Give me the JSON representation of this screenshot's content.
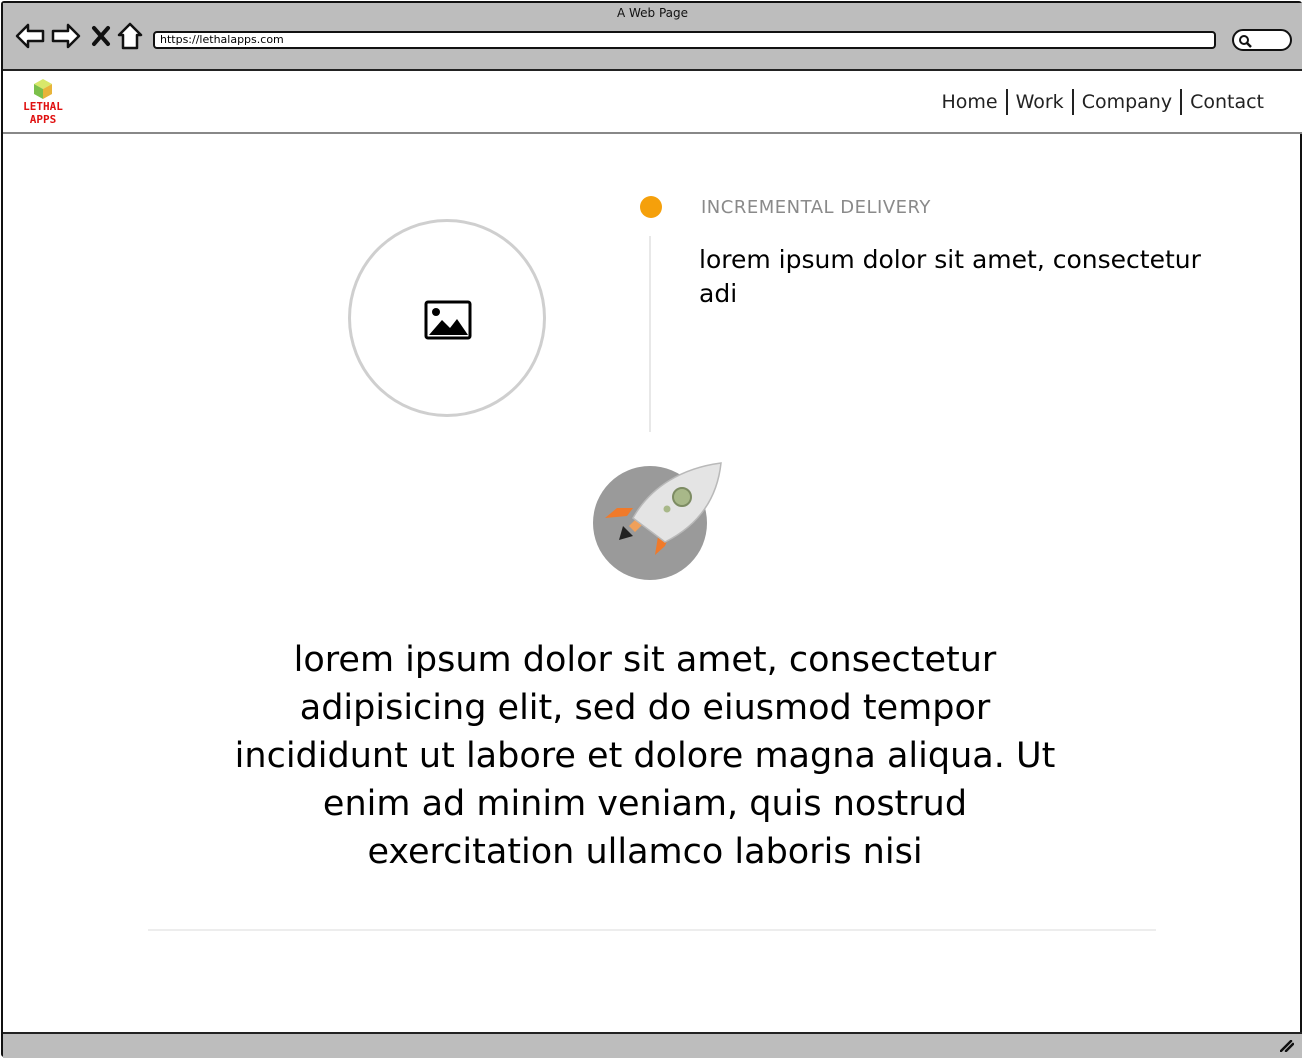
{
  "window": {
    "title": "A Web Page",
    "url": "https://lethalapps.com"
  },
  "browser_controls": {
    "back_icon": "arrow-left-icon",
    "forward_icon": "arrow-right-icon",
    "close_icon": "x-icon",
    "home_icon": "home-icon",
    "search_icon": "search-icon"
  },
  "header": {
    "logo_line1": "LETHAL",
    "logo_line2": "APPS",
    "menu": [
      {
        "label": "Home"
      },
      {
        "label": "Work"
      },
      {
        "label": "Company"
      },
      {
        "label": "Contact"
      }
    ]
  },
  "timeline": {
    "step_title": "INCREMENTAL DELIVERY",
    "step_text": "lorem ipsum dolor sit amet, consectetur adi",
    "dot_color": "#f5a00b",
    "image_icon": "image-placeholder-icon"
  },
  "feature": {
    "icon": "rocket-icon",
    "text": "lorem ipsum dolor sit amet, consectetur adipisicing elit, sed do eiusmod tempor incididunt ut labore et dolore magna aliqua. Ut enim ad minim veniam, quis nostrud exercitation ullamco laboris nisi"
  }
}
